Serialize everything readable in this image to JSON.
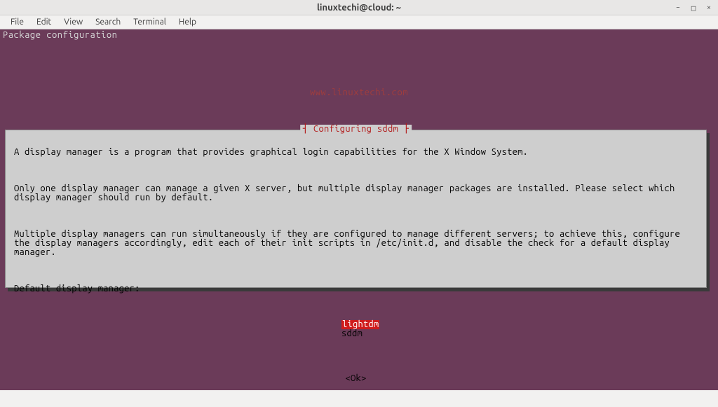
{
  "window": {
    "title": "linuxtechi@cloud: ~"
  },
  "menu": {
    "file": "File",
    "edit": "Edit",
    "view": "View",
    "search": "Search",
    "terminal": "Terminal",
    "help": "Help"
  },
  "terminal": {
    "header": "Package configuration",
    "watermark": "www.linuxtechi.com"
  },
  "dialog": {
    "title": "Configuring sddm",
    "para1": "A display manager is a program that provides graphical login capabilities for the X Window System.",
    "para2": "Only one display manager can manage a given X server, but multiple display manager packages are installed. Please select which display manager should run by default.",
    "para3": "Multiple display managers can run simultaneously if they are configured to manage different servers; to achieve this, configure the display managers accordingly, edit each of their init scripts in /etc/init.d, and disable the check for a default display manager.",
    "prompt": "Default display manager:",
    "options": {
      "selected": "lightdm",
      "other": "sddm"
    },
    "ok": "<Ok>"
  }
}
